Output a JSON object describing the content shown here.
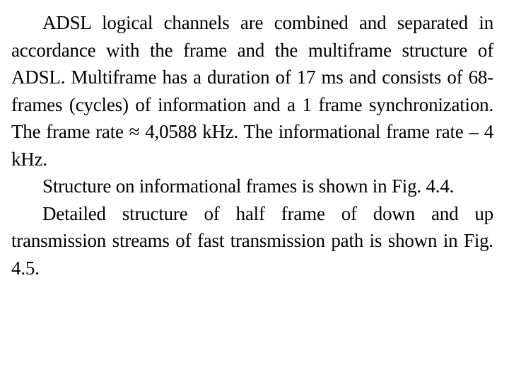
{
  "paragraphs": [
    "ADSL logical channels are combined and separated in accordance with the frame and the multiframe structure of ADSL. Multiframe has a duration of 17 ms and consists of 68-frames (cycles) of information and a 1 frame synchronization. The frame rate ≈ 4,0588 kHz. The informational frame rate – 4 kHz.",
    "Structure on informational frames is shown in Fig. 4.4.",
    "Detailed structure of half frame of down and up transmission streams of fast transmission path is shown in Fig. 4.5."
  ]
}
